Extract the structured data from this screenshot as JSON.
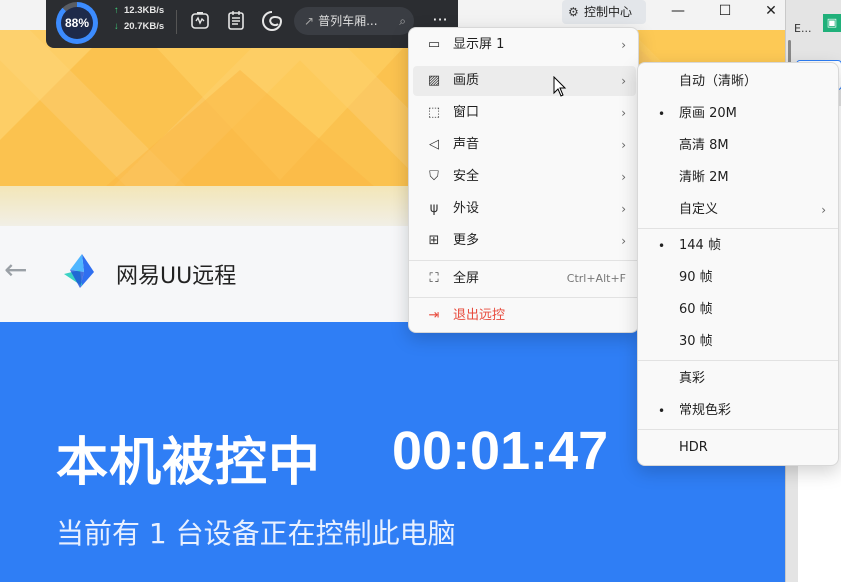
{
  "toolbar": {
    "quality_percent": "88%",
    "upload_speed": "12.3KB/s",
    "download_speed": "20.7KB/s",
    "search_text": "普列车厢...",
    "icons": [
      "performance-icon",
      "notes-icon",
      "edge-icon",
      "more-icon"
    ]
  },
  "window": {
    "control_center_label": "控制中心",
    "minimize": "—",
    "maximize": "☐",
    "close": "✕"
  },
  "app": {
    "title": "网易UU远程",
    "status_main": "本机被控中",
    "timer": "00:01:47",
    "status_sub": "当前有 1 台设备正在控制此电脑"
  },
  "main_menu": {
    "items": [
      {
        "label": "显示屏 1",
        "icon": "monitor-icon",
        "submenu": true
      },
      {
        "label": "画质",
        "icon": "image-icon",
        "submenu": true
      },
      {
        "label": "窗口",
        "icon": "window-icon",
        "submenu": true
      },
      {
        "label": "声音",
        "icon": "speaker-icon",
        "submenu": true
      },
      {
        "label": "安全",
        "icon": "shield-icon",
        "submenu": true
      },
      {
        "label": "外设",
        "icon": "usb-icon",
        "submenu": true
      },
      {
        "label": "更多",
        "icon": "grid-icon",
        "submenu": true
      },
      {
        "label": "全屏",
        "icon": "fullscreen-icon",
        "shortcut": "Ctrl+Alt+F"
      },
      {
        "label": "退出远控",
        "icon": "exit-icon"
      }
    ]
  },
  "quality_submenu": {
    "items": [
      {
        "label": "自动（清晰）",
        "selected": false
      },
      {
        "label": "原画 20M",
        "selected": true
      },
      {
        "label": "高清 8M",
        "selected": false
      },
      {
        "label": "清晰 2M",
        "selected": false
      },
      {
        "label": "自定义",
        "selected": false,
        "submenu": true
      },
      {
        "label": "144 帧",
        "selected": true
      },
      {
        "label": "90 帧",
        "selected": false
      },
      {
        "label": "60 帧",
        "selected": false
      },
      {
        "label": "30 帧",
        "selected": false
      },
      {
        "label": "真彩",
        "selected": false
      },
      {
        "label": "常规色彩",
        "selected": true
      },
      {
        "label": "HDR",
        "selected": false
      }
    ]
  },
  "side": {
    "fragment_text": "E..."
  }
}
